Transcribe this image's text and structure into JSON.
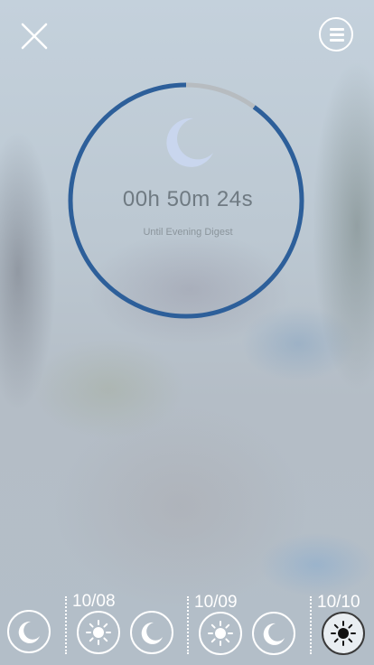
{
  "header": {
    "close_icon": "close-icon",
    "menu_icon": "hamburger-menu-icon"
  },
  "countdown": {
    "time_remaining": "00h 50m 24s",
    "subtitle": "Until Evening Digest",
    "progress_fraction": 0.9,
    "icon": "moon-icon",
    "colors": {
      "progress": "#2d5f9a",
      "track": "#b7bcc0",
      "moon": "#c9d6ee"
    }
  },
  "timeline": {
    "days": [
      {
        "date": "",
        "items": [
          {
            "icon": "moon-icon",
            "active": false
          }
        ]
      },
      {
        "date": "10/08",
        "items": [
          {
            "icon": "sun-icon",
            "active": false
          },
          {
            "icon": "moon-icon",
            "active": false
          }
        ]
      },
      {
        "date": "10/09",
        "items": [
          {
            "icon": "sun-icon",
            "active": false
          },
          {
            "icon": "moon-icon",
            "active": false
          }
        ]
      },
      {
        "date": "10/10",
        "items": [
          {
            "icon": "sun-icon",
            "active": true
          }
        ]
      }
    ]
  }
}
